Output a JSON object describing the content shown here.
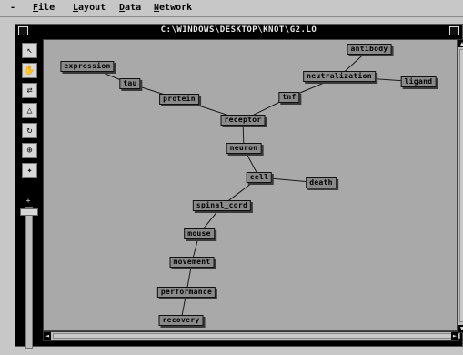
{
  "menu": {
    "dash": "-",
    "items": [
      {
        "label": "File",
        "ul": "F",
        "rest": "ile"
      },
      {
        "label": "Layout",
        "ul": "L",
        "rest": "ayout"
      },
      {
        "label": "Data",
        "ul": "D",
        "rest": "ata"
      },
      {
        "label": "Network",
        "ul": "N",
        "rest": "etwork"
      }
    ]
  },
  "window": {
    "title": "C:\\WINDOWS\\DESKTOP\\KNOT\\G2.LO"
  },
  "toolbar": {
    "tools": [
      {
        "name": "select-tool-icon",
        "glyph": "↖"
      },
      {
        "name": "hand-tool-icon",
        "glyph": "✋"
      },
      {
        "name": "link-tool-icon",
        "glyph": "⇄"
      },
      {
        "name": "triangle-tool-icon",
        "glyph": "△"
      },
      {
        "name": "rotate-tool-icon",
        "glyph": "↻"
      },
      {
        "name": "center-tool-icon",
        "glyph": "⊕"
      },
      {
        "name": "expand-tool-icon",
        "glyph": "✦"
      }
    ],
    "zoom_plus": "+",
    "zoom_minus": "−"
  },
  "network": {
    "nodes": [
      {
        "id": "antibody",
        "label": "antibody"
      },
      {
        "id": "expression",
        "label": "expression"
      },
      {
        "id": "neutralization",
        "label": "neutralization"
      },
      {
        "id": "ligand",
        "label": "ligand"
      },
      {
        "id": "tau",
        "label": "tau"
      },
      {
        "id": "tnf",
        "label": "tnf"
      },
      {
        "id": "protein",
        "label": "protein"
      },
      {
        "id": "receptor",
        "label": "receptor"
      },
      {
        "id": "neuron",
        "label": "neuron"
      },
      {
        "id": "cell",
        "label": "cell"
      },
      {
        "id": "death",
        "label": "death"
      },
      {
        "id": "spinal_cord",
        "label": "spinal_cord"
      },
      {
        "id": "mouse",
        "label": "mouse"
      },
      {
        "id": "movement",
        "label": "movement"
      },
      {
        "id": "performance",
        "label": "performance"
      },
      {
        "id": "recovery",
        "label": "recovery"
      }
    ],
    "edges": [
      [
        "expression",
        "tau"
      ],
      [
        "tau",
        "protein"
      ],
      [
        "protein",
        "receptor"
      ],
      [
        "antibody",
        "neutralization"
      ],
      [
        "neutralization",
        "ligand"
      ],
      [
        "neutralization",
        "tnf"
      ],
      [
        "tnf",
        "receptor"
      ],
      [
        "receptor",
        "neuron"
      ],
      [
        "neuron",
        "cell"
      ],
      [
        "cell",
        "death"
      ],
      [
        "cell",
        "spinal_cord"
      ],
      [
        "spinal_cord",
        "mouse"
      ],
      [
        "mouse",
        "movement"
      ],
      [
        "movement",
        "performance"
      ],
      [
        "performance",
        "recovery"
      ]
    ]
  },
  "scroll": {
    "left": "◄",
    "right": "►",
    "up": "▲",
    "down": "▼"
  }
}
